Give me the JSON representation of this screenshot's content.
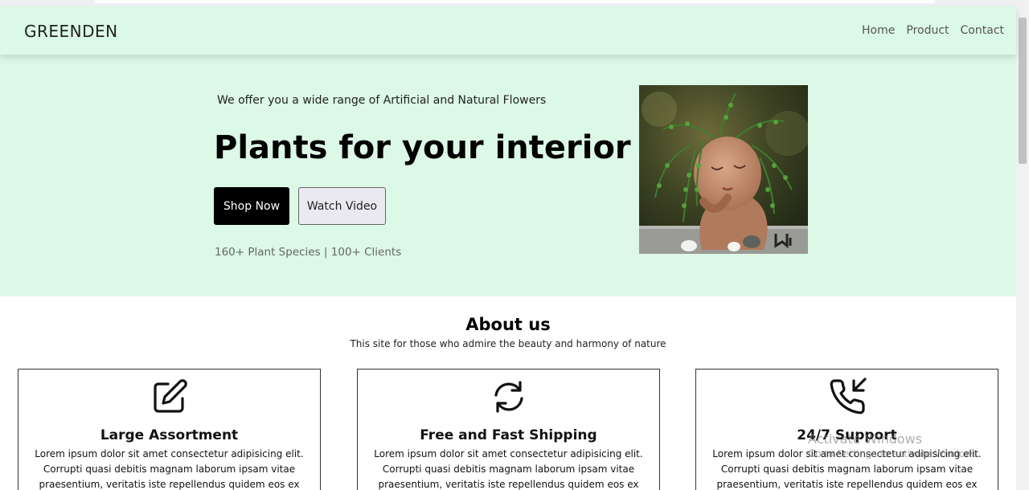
{
  "navbar": {
    "brand": "GREENDEN",
    "links": [
      "Home",
      "Product",
      "Contact"
    ]
  },
  "hero": {
    "tagline": "We offer you a wide range of Artificial and Natural Flowers",
    "headline": "Plants for your interior",
    "shop_button": "Shop Now",
    "watch_button": "Watch Video",
    "stats": "160+ Plant Species | 100+ Clients"
  },
  "about": {
    "title": "About us",
    "subtitle": "This site for those who admire the beauty and harmony of nature",
    "cards": [
      {
        "icon": "pencil-square-icon",
        "title": "Large Assortment",
        "description": "Lorem ipsum dolor sit amet consectetur adipisicing elit. Corrupti quasi debitis magnam laborum ipsam vitae praesentium, veritatis iste repellendus quidem eos ex"
      },
      {
        "icon": "refresh-arrows-icon",
        "title": "Free and Fast Shipping",
        "description": "Lorem ipsum dolor sit amet consectetur adipisicing elit. Corrupti quasi debitis magnam laborum ipsam vitae praesentium, veritatis iste repellendus quidem eos ex"
      },
      {
        "icon": "phone-incoming-icon",
        "title": "24/7 Support",
        "description": "Lorem ipsum dolor sit amet consectetur adipisicing elit. Corrupti quasi debitis magnam laborum ipsam vitae praesentium, veritatis iste repellendus quidem eos ex"
      }
    ]
  },
  "watermark": {
    "line1": "Activate Windows",
    "line2": "Go to Settings to activate Windows."
  },
  "colors": {
    "hero_background": "#dcf8e6",
    "primary_button": "#000000",
    "secondary_button": "#e9e9ef"
  }
}
